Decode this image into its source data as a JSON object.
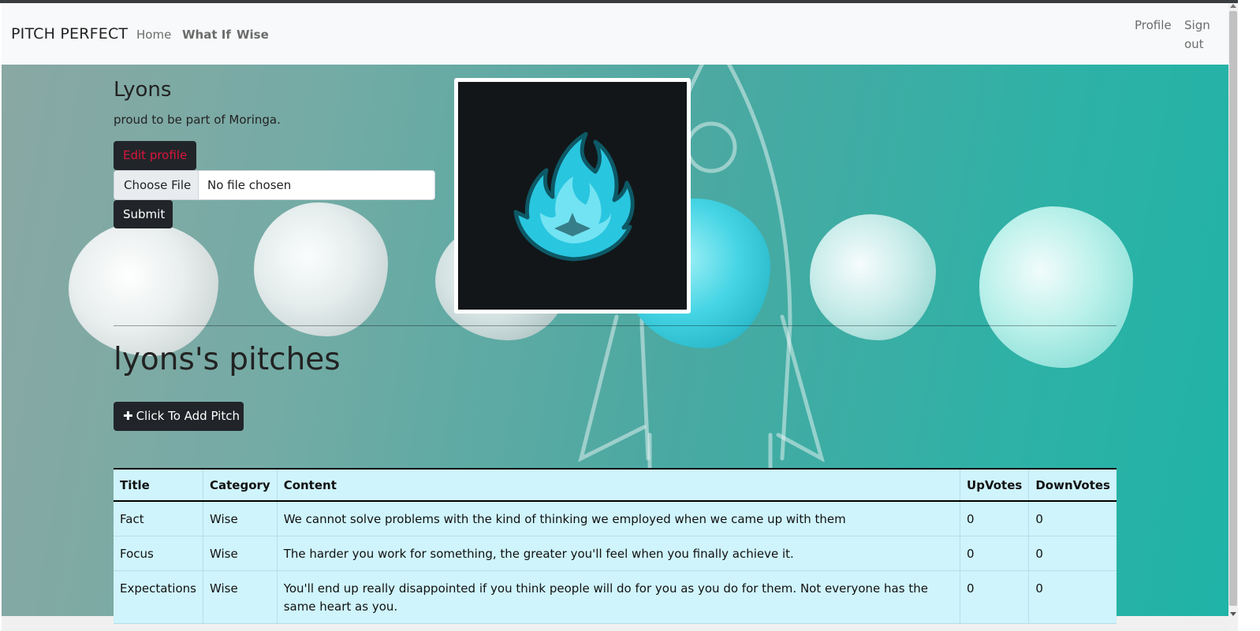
{
  "navbar": {
    "brand": "PITCH PERFECT",
    "links": [
      "Home",
      "What If",
      "Wise"
    ],
    "profile": "Profile",
    "signout_line1": "Sign",
    "signout_line2": "out"
  },
  "profile": {
    "name": "Lyons",
    "bio": "proud to be part of Moringa.",
    "edit_label": "Edit profile",
    "file_button_label": "Choose File",
    "file_status": "No file chosen",
    "submit_label": "Submit",
    "avatar_icon": "flame-logo-icon"
  },
  "pitches": {
    "heading": "lyons's pitches",
    "add_label": "Click To Add Pitch",
    "table": {
      "headers": [
        "Title",
        "Category",
        "Content",
        "UpVotes",
        "DownVotes"
      ],
      "rows": [
        [
          "Fact",
          "Wise",
          "We cannot solve problems with the kind of thinking we employed when we came up with them",
          "0",
          "0"
        ],
        [
          "Focus",
          "Wise",
          "The harder you work for something, the greater you'll feel when you finally achieve it.",
          "0",
          "0"
        ],
        [
          "Expectations",
          "Wise",
          "You'll end up really disappointed if you think people will do for you as you do for them. Not everyone has the same heart as you.",
          "0",
          "0"
        ]
      ]
    }
  },
  "colors": {
    "navbar_bg": "#f8f9fa",
    "dark_button": "#212529",
    "edit_text": "#dc143c",
    "table_bg": "#cff4fc",
    "teal_bg": "#2fb1a6",
    "flame": "#29c6e0"
  }
}
